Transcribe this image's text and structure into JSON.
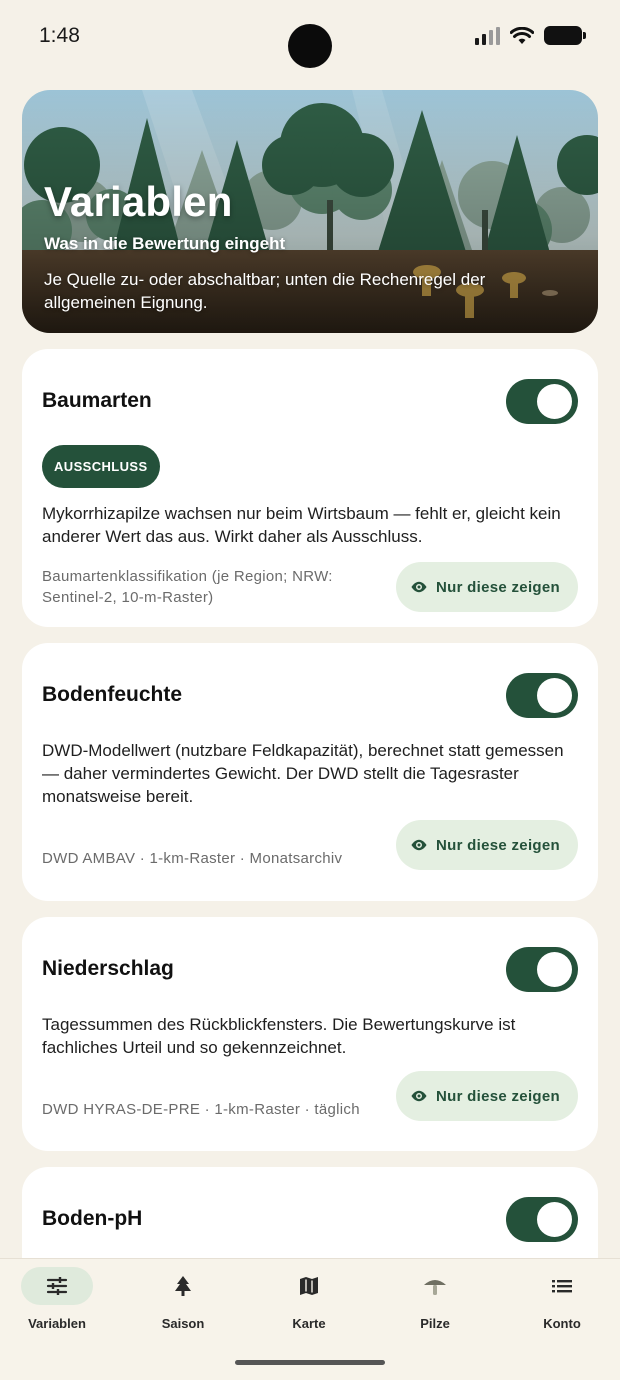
{
  "status_bar": {
    "time": "1:48"
  },
  "hero": {
    "title": "Variablen",
    "subtitle": "Was in die Bewertung eingeht",
    "description": "Je Quelle zu- oder abschaltbar; unten die Rechenregel der allgemeinen Eignung."
  },
  "cards": [
    {
      "title": "Baumarten",
      "enabled": true,
      "badge": "AUSSCHLUSS",
      "description": "Mykorrhizapilze wachsen nur beim Wirtsbaum — fehlt er, gleicht kein anderer Wert das aus. Wirkt daher als Ausschluss.",
      "source": "Baumartenklassifikation (je Region; NRW: Sentinel-2, 10-m-Raster)",
      "button": "Nur diese zeigen"
    },
    {
      "title": "Bodenfeuchte",
      "enabled": true,
      "description": "DWD-Modellwert (nutzbare Feldkapazität), berechnet statt gemessen — daher vermindertes Gewicht. Der DWD stellt die Tagesraster monatsweise bereit.",
      "source": "DWD AMBAV · 1-km-Raster · Monatsarchiv",
      "button": "Nur diese zeigen"
    },
    {
      "title": "Niederschlag",
      "enabled": true,
      "description": "Tagessummen des Rückblickfensters. Die Bewertungskurve ist fachliches Urteil und so gekennzeichnet.",
      "source": "DWD HYRAS-DE-PRE · 1-km-Raster · täglich",
      "button": "Nur diese zeigen"
    },
    {
      "title": "Boden-pH",
      "enabled": true
    }
  ],
  "nav": [
    {
      "label": "Variablen",
      "icon": "sliders-icon",
      "active": true
    },
    {
      "label": "Saison",
      "icon": "tree-icon",
      "active": false
    },
    {
      "label": "Karte",
      "icon": "map-icon",
      "active": false
    },
    {
      "label": "Pilze",
      "icon": "mushroom-icon",
      "active": false
    },
    {
      "label": "Konto",
      "icon": "list-icon",
      "active": false
    }
  ],
  "colors": {
    "background": "#f5f1e8",
    "accent": "#24513a",
    "chip": "#e4efe1"
  }
}
